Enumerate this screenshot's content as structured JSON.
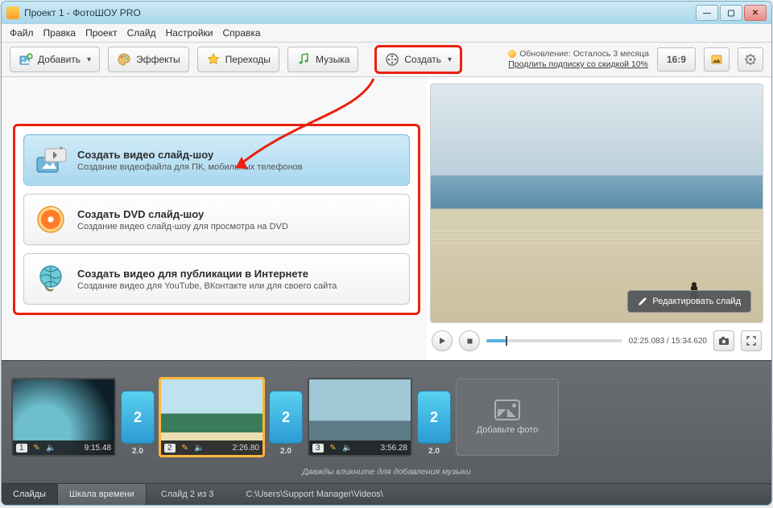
{
  "title": "Проект 1 - ФотоШОУ PRO",
  "menu": [
    "Файл",
    "Правка",
    "Проект",
    "Слайд",
    "Настройки",
    "Справка"
  ],
  "toolbar": {
    "add": "Добавить",
    "effects": "Эффекты",
    "transitions": "Переходы",
    "music": "Музыка",
    "create": "Создать"
  },
  "update": {
    "line1": "Обновление: Осталось 3 месяца",
    "line2": "Продлить подписку со скидкой 10%"
  },
  "ratio": "16:9",
  "options": [
    {
      "title": "Создать видео слайд-шоу",
      "desc": "Создание видеофайла для ПК, мобильных телефонов"
    },
    {
      "title": "Создать DVD слайд-шоу",
      "desc": "Создание видео слайд-шоу для просмотра на DVD"
    },
    {
      "title": "Создать видео для публикации в Интернете",
      "desc": "Создание видео для YouTube, ВКонтакте или для своего сайта"
    }
  ],
  "preview": {
    "edit_btn": "Редактировать слайд",
    "time_current": "02:25.083",
    "time_total": "15:34.620"
  },
  "slides": [
    {
      "n": "1",
      "dur": "9:15.48"
    },
    {
      "n": "2",
      "dur": "2:26.80"
    },
    {
      "n": "3",
      "dur": "3:56.28"
    }
  ],
  "transitions": [
    {
      "type": "2",
      "dur": "2.0"
    },
    {
      "type": "2",
      "dur": "2.0"
    },
    {
      "type": "2",
      "dur": "2.0"
    }
  ],
  "add_slot": "Добавьте фото",
  "music_hint": "Дважды кликните для добавления музыки",
  "footer": {
    "tab1": "Слайды",
    "tab2": "Шкала времени",
    "status_left": "Слайд 2 из 3",
    "status_path": "C:\\Users\\Support Manager\\Videos\\"
  }
}
